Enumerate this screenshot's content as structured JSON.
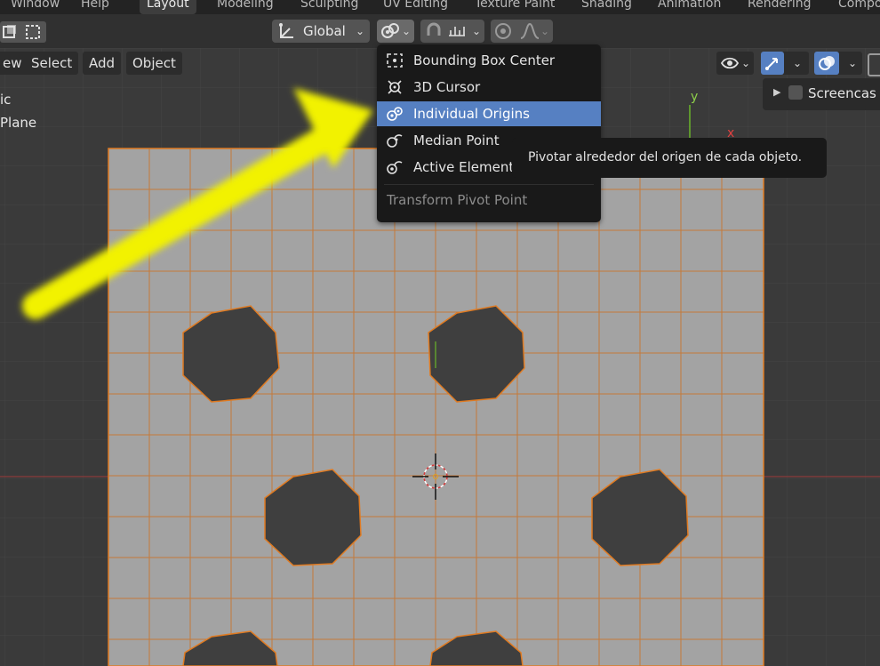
{
  "workspace_tabs": [
    {
      "label": "Window"
    },
    {
      "label": "Help"
    },
    {
      "label": "Layout"
    },
    {
      "label": "Modeling"
    },
    {
      "label": "Sculpting"
    },
    {
      "label": "UV Editing"
    },
    {
      "label": "Texture Paint"
    },
    {
      "label": "Shading"
    },
    {
      "label": "Animation"
    },
    {
      "label": "Rendering"
    },
    {
      "label": "Compo"
    }
  ],
  "active_tab": "Layout",
  "toolbar": {
    "orientation_label": "Global",
    "orientation_icon": "transform-orientation-icon",
    "pivot_icon": "pivot-individual-origins-icon",
    "snap_icon": "snap-magnet-icon",
    "snap_target_icon": "snap-increment-icon",
    "proportional_icon": "proportional-edit-icon",
    "falloff_icon": "falloff-curve-icon"
  },
  "header": {
    "view_label": "ew",
    "select_label": "Select",
    "add_label": "Add",
    "object_label": "Object"
  },
  "viewport_overlay": {
    "line1": "ic",
    "line2": "Plane",
    "axis_y": "y",
    "axis_x": "x"
  },
  "side_panel": {
    "label": "Screencas"
  },
  "pivot_menu": {
    "items": [
      {
        "label": "Bounding Box Center",
        "icon": "bounding-box-center-icon"
      },
      {
        "label": "3D Cursor",
        "icon": "3d-cursor-icon"
      },
      {
        "label": "Individual Origins",
        "icon": "individual-origins-icon",
        "selected": true
      },
      {
        "label": "Median Point",
        "icon": "median-point-icon"
      },
      {
        "label": "Active Element",
        "icon": "active-element-icon"
      }
    ],
    "footer": "Transform Pivot Point"
  },
  "tooltip": {
    "text": "Pivotar alrededor del origen de cada objeto."
  },
  "colors": {
    "menu_bg": "#191919",
    "menu_selected": "#5680c2",
    "mesh_face": "#a3a3a3",
    "mesh_edge": "#e07b22",
    "hole": "#3f3f3f",
    "arrow": "#f2f200",
    "viewport_bg": "#3a3a3a"
  }
}
